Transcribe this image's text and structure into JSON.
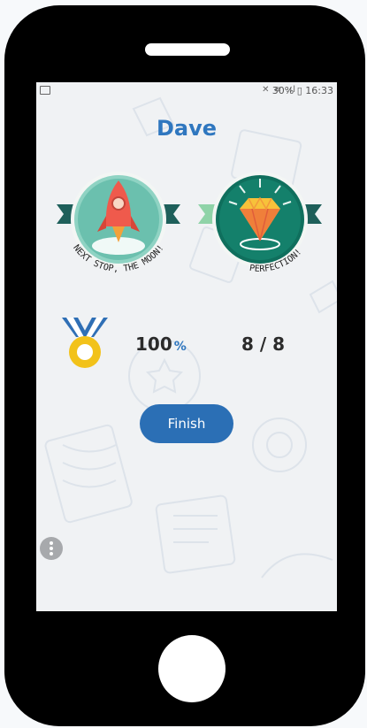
{
  "status_bar": {
    "signal_icons": "✕ ≋ .ıl",
    "battery_time": "30% ▯ 16:33"
  },
  "player": {
    "name": "Dave"
  },
  "badges": [
    {
      "icon": "rocket-icon",
      "caption": "NEXT STOP, THE MOON!"
    },
    {
      "icon": "diamond-icon",
      "caption": "PERFECTION!"
    }
  ],
  "results": {
    "percent_value": "100",
    "percent_symbol": "%",
    "score": "8 / 8"
  },
  "actions": {
    "finish_label": "Finish"
  },
  "colors": {
    "accent": "#2f77bf",
    "button": "#2b6fb5",
    "rocket_badge": "#7cc9b9",
    "gem_badge": "#14806b",
    "ribbon": "#1e5f5a"
  }
}
